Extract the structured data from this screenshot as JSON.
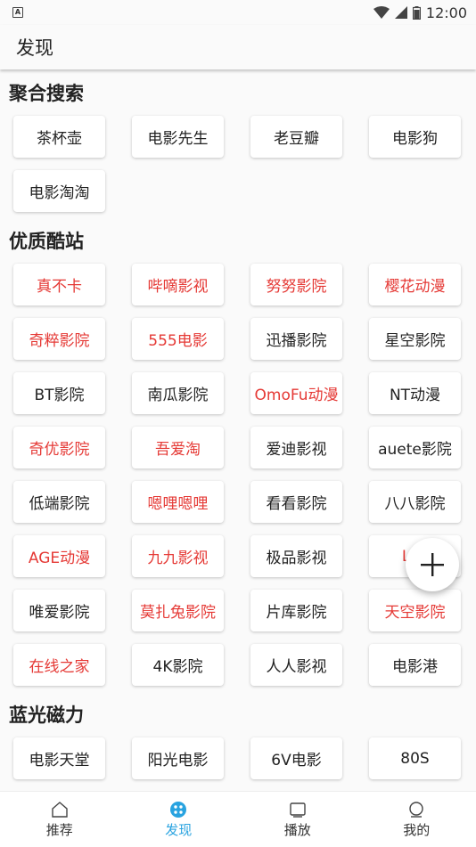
{
  "status_bar": {
    "time": "12:00",
    "badge": "A"
  },
  "app_bar": {
    "title": "发现"
  },
  "sections": [
    {
      "title": "聚合搜索",
      "items": [
        {
          "label": "茶杯壶",
          "red": false
        },
        {
          "label": "电影先生",
          "red": false
        },
        {
          "label": "老豆瓣",
          "red": false
        },
        {
          "label": "电影狗",
          "red": false
        },
        {
          "label": "电影淘淘",
          "red": false
        }
      ]
    },
    {
      "title": "优质酷站",
      "items": [
        {
          "label": "真不卡",
          "red": true
        },
        {
          "label": "哔嘀影视",
          "red": true
        },
        {
          "label": "努努影院",
          "red": true
        },
        {
          "label": "樱花动漫",
          "red": true
        },
        {
          "label": "奇粹影院",
          "red": true
        },
        {
          "label": "555电影",
          "red": true
        },
        {
          "label": "迅播影院",
          "red": false
        },
        {
          "label": "星空影院",
          "red": false
        },
        {
          "label": "BT影院",
          "red": false
        },
        {
          "label": "南瓜影院",
          "red": false
        },
        {
          "label": "OmoFu动漫",
          "red": true
        },
        {
          "label": "NT动漫",
          "red": false
        },
        {
          "label": "奇优影院",
          "red": true
        },
        {
          "label": "吾爱淘",
          "red": true
        },
        {
          "label": "爱迪影视",
          "red": false
        },
        {
          "label": "auete影院",
          "red": false
        },
        {
          "label": "低端影院",
          "red": false
        },
        {
          "label": "嗯哩嗯哩",
          "red": true
        },
        {
          "label": "看看影院",
          "red": false
        },
        {
          "label": "八八影院",
          "red": false
        },
        {
          "label": "AGE动漫",
          "red": true
        },
        {
          "label": "九九影视",
          "red": true
        },
        {
          "label": "极品影视",
          "red": false
        },
        {
          "label": "LIM",
          "red": true
        },
        {
          "label": "唯爱影院",
          "red": false
        },
        {
          "label": "莫扎兔影院",
          "red": true
        },
        {
          "label": "片库影院",
          "red": false
        },
        {
          "label": "天空影院",
          "red": true
        },
        {
          "label": "在线之家",
          "red": true
        },
        {
          "label": "4K影院",
          "red": false
        },
        {
          "label": "人人影视",
          "red": false
        },
        {
          "label": "电影港",
          "red": false
        }
      ]
    },
    {
      "title": "蓝光磁力",
      "items": [
        {
          "label": "电影天堂",
          "red": false
        },
        {
          "label": "阳光电影",
          "red": false
        },
        {
          "label": "6V电影",
          "red": false
        },
        {
          "label": "80S",
          "red": false
        }
      ]
    }
  ],
  "bottom_nav": [
    {
      "label": "推荐",
      "icon": "home-icon",
      "active": false
    },
    {
      "label": "发现",
      "icon": "discover-icon",
      "active": true
    },
    {
      "label": "播放",
      "icon": "play-icon",
      "active": false
    },
    {
      "label": "我的",
      "icon": "profile-icon",
      "active": false
    }
  ],
  "colors": {
    "accent": "#29a3e0",
    "highlight_red": "#e53935"
  }
}
